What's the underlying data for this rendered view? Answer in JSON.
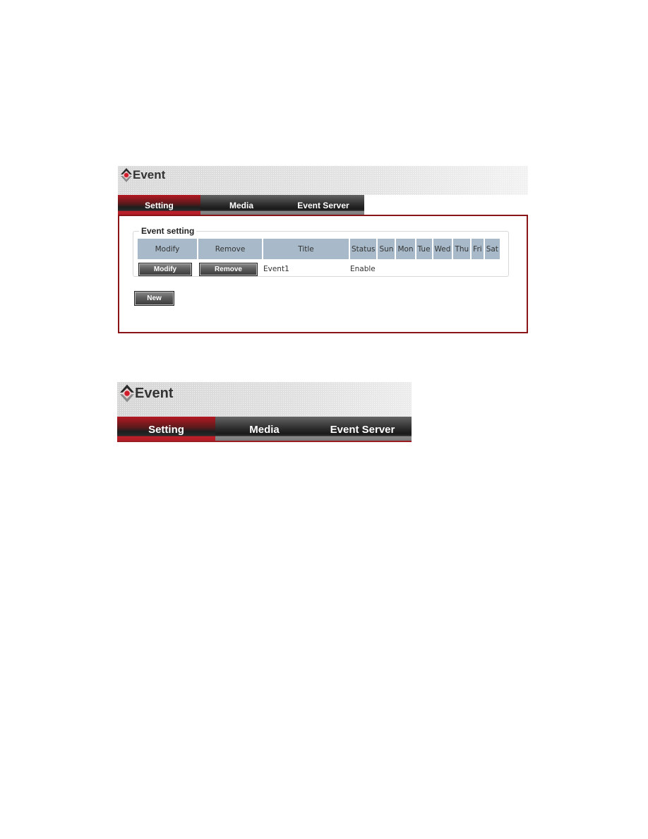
{
  "panel_full": {
    "title": "Event",
    "logo_icon": "camera-eye-logo-icon",
    "tabs": [
      {
        "label": "Setting",
        "active": true
      },
      {
        "label": "Media",
        "active": false
      },
      {
        "label": "Event Server",
        "active": false
      }
    ],
    "fieldset_legend": "Event setting",
    "table": {
      "headers": [
        "Modify",
        "Remove",
        "Title",
        "Status",
        "Sun",
        "Mon",
        "Tue",
        "Wed",
        "Thu",
        "Fri",
        "Sat"
      ],
      "rows": [
        {
          "modify_button": "Modify",
          "remove_button": "Remove",
          "title": "Event1",
          "status": "Enable",
          "days": [
            "",
            "",
            "",
            "",
            "",
            "",
            ""
          ]
        }
      ]
    },
    "new_button": "New",
    "colors": {
      "active_tab": "#b41822",
      "border": "#8a1519",
      "header_cell": "#a8bac9"
    }
  },
  "panel_zoomed": {
    "title": "Event",
    "tabs": [
      {
        "label": "Setting",
        "active": true
      },
      {
        "label": "Media",
        "active": false
      },
      {
        "label": "Event Server",
        "active": false
      }
    ]
  }
}
